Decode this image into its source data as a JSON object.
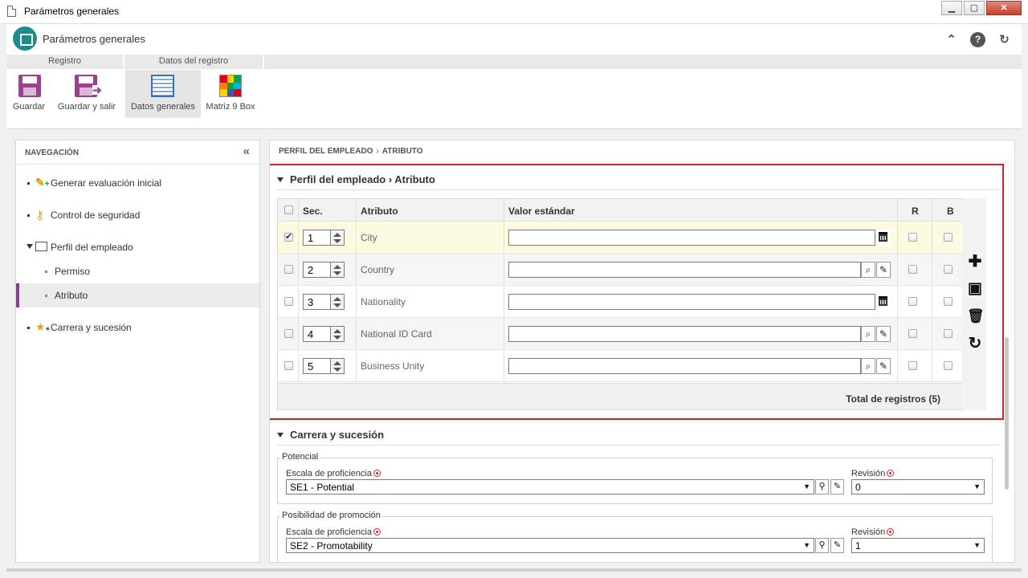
{
  "window": {
    "title": "Parámetros generales",
    "btn_min": "▁",
    "btn_max": "▢",
    "btn_close": "✕"
  },
  "app": {
    "title": "Parámetros generales",
    "icons": [
      "collapse-up-icon",
      "help-icon",
      "refresh-icon"
    ],
    "glyph_collapse": "⌃",
    "glyph_help": "?",
    "glyph_refresh": "↻"
  },
  "ribbon": {
    "groups": [
      {
        "label": "Registro"
      },
      {
        "label": "Datos del registro"
      }
    ],
    "buttons": [
      {
        "label": "Guardar",
        "icon": "floppy-icon"
      },
      {
        "label": "Guardar y salir",
        "icon": "floppy-exit-icon"
      },
      {
        "label": "Datos generales",
        "icon": "table-icon",
        "active": true
      },
      {
        "label": "Matriz 9 Box",
        "icon": "matrix-icon"
      }
    ],
    "matrix_colors": [
      "#e0001b",
      "#ffd200",
      "#00a651",
      "#ff7f00",
      "#00a651",
      "#00b4e6",
      "#ffd200",
      "#3b5aa8",
      "#e0001b"
    ]
  },
  "nav": {
    "header": "NAVEGACIÓN",
    "collapse_glyph": "«",
    "items": [
      {
        "label": "Generar evaluación inicial",
        "icon": "evaluation-icon"
      },
      {
        "label": "Control de seguridad",
        "icon": "key-icon"
      },
      {
        "label": "Perfil del empleado",
        "icon": "profile-icon",
        "expanded": true
      },
      {
        "label": "Permiso",
        "sub": true
      },
      {
        "label": "Atributo",
        "sub": true,
        "selected": true
      },
      {
        "label": "Carrera y sucesión",
        "icon": "career-icon"
      }
    ]
  },
  "breadcrumb": {
    "part1": "PERFIL DEL EMPLEADO",
    "sep": "›",
    "part2": "ATRIBUTO"
  },
  "section1": {
    "title": "Perfil del empleado › Atributo",
    "columns": {
      "sec": "Sec.",
      "attr": "Atributo",
      "value": "Valor estándar",
      "r": "R",
      "b": "B"
    },
    "rows": [
      {
        "checked": true,
        "sec": "1",
        "attr": "City",
        "type": "calendar"
      },
      {
        "checked": false,
        "sec": "2",
        "attr": "Country",
        "type": "lookup"
      },
      {
        "checked": false,
        "sec": "3",
        "attr": "Nationality",
        "type": "calendar"
      },
      {
        "checked": false,
        "sec": "4",
        "attr": "National ID Card",
        "type": "lookup"
      },
      {
        "checked": false,
        "sec": "5",
        "attr": "Business Unity",
        "type": "lookup"
      }
    ],
    "total": "Total de registros (5)",
    "tools": {
      "add": "✚",
      "save": "▣",
      "delete": "🗑",
      "refresh": "↻"
    }
  },
  "section2": {
    "title": "Carrera y sucesión",
    "potencial": {
      "legend": "Potencial",
      "scale_label": "Escala de proficiencia",
      "scale_value": "SE1 - Potential",
      "rev_label": "Revisión",
      "rev_value": "0"
    },
    "promocion": {
      "legend": "Posibilidad de promoción",
      "scale_label": "Escala de proficiencia",
      "scale_value": "SE2 - Promotability",
      "rev_label": "Revisión",
      "rev_value": "1"
    },
    "glyph_search": "⌕",
    "glyph_clear": "✎"
  },
  "colors": {
    "accent": "#8a3e90",
    "teal": "#1e8c8c",
    "highlight": "#d4202b"
  }
}
